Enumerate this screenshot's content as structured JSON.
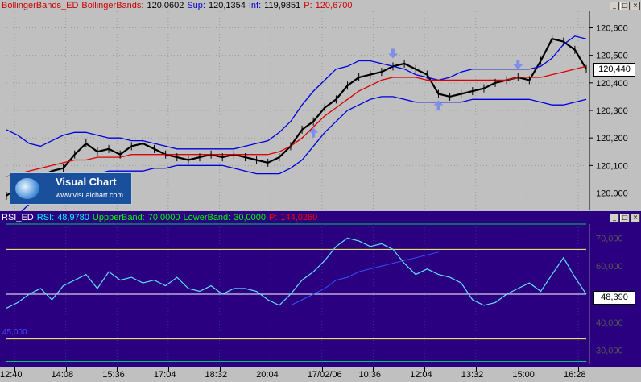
{
  "windows": {
    "price": {
      "legend": [
        {
          "text": "BollingerBands_ED",
          "color": "#cc0000"
        },
        {
          "text": "BollingerBands:",
          "color": "#cc0000"
        },
        {
          "text": "120,0602",
          "color": "#000000"
        },
        {
          "text": "Sup:",
          "color": "#0000cc"
        },
        {
          "text": "120,1354",
          "color": "#000000"
        },
        {
          "text": "Inf:",
          "color": "#0000cc"
        },
        {
          "text": "119,9851",
          "color": "#000000"
        },
        {
          "text": "P:",
          "color": "#cc0000"
        },
        {
          "text": "120,6700",
          "color": "#cc0000"
        }
      ],
      "last_price_label": "120,440",
      "logo": {
        "title": "Visual Chart",
        "url": "www.visualchart.com"
      }
    },
    "rsi": {
      "legend": [
        {
          "text": "RSI_ED",
          "color": "#ffffff"
        },
        {
          "text": "RSI:",
          "color": "#00ffff"
        },
        {
          "text": "48,9780",
          "color": "#00ffff"
        },
        {
          "text": "UppperBand:",
          "color": "#00ff00"
        },
        {
          "text": "70,0000",
          "color": "#00ff00"
        },
        {
          "text": "LowerBand:",
          "color": "#00ff00"
        },
        {
          "text": "30,0000",
          "color": "#00ff00"
        },
        {
          "text": "P:",
          "color": "#ff0000"
        },
        {
          "text": "144,0260",
          "color": "#ff0000"
        }
      ],
      "last_value_label": "48,390",
      "left_label": "45,000"
    },
    "buttons": [
      "_",
      "□",
      "×"
    ]
  },
  "colors": {
    "price_bg": "#c0c0c0",
    "rsi_bg": "#2a0080",
    "grid": "#9a9a9a",
    "upper_band": "#0000dd",
    "lower_band": "#0000dd",
    "mid_band": "#dd0000",
    "price": "#000000",
    "rsi_line": "#66ddff",
    "upper_line": "#ffff66",
    "lower_line": "#ffff66",
    "level_line": "#00cc66",
    "arrow": "#7f8fe8"
  },
  "chart_data": [
    {
      "type": "line",
      "title": "BollingerBands_ED",
      "y_ticks": [
        "120,600",
        "120,500",
        "120,400",
        "120,300",
        "120,200",
        "120,100",
        "120,000"
      ],
      "y_tick_values": [
        120.6,
        120.5,
        120.4,
        120.3,
        120.2,
        120.1,
        120.0
      ],
      "ylim": [
        119.94,
        120.66
      ],
      "grid": true,
      "series": [
        {
          "name": "Price",
          "values": [
            119.99,
            120.02,
            120.04,
            120.06,
            120.08,
            120.09,
            120.14,
            120.18,
            120.15,
            120.16,
            120.14,
            120.17,
            120.18,
            120.16,
            120.14,
            120.13,
            120.12,
            120.13,
            120.14,
            120.13,
            120.14,
            120.13,
            120.12,
            120.11,
            120.13,
            120.17,
            120.23,
            120.26,
            120.31,
            120.34,
            120.39,
            120.42,
            120.43,
            120.44,
            120.46,
            120.47,
            120.45,
            120.43,
            120.36,
            120.35,
            120.36,
            120.37,
            120.38,
            120.4,
            120.41,
            120.42,
            120.41,
            120.48,
            120.56,
            120.55,
            120.52,
            120.45
          ]
        },
        {
          "name": "Upper Band",
          "values": [
            120.23,
            120.21,
            120.18,
            120.17,
            120.19,
            120.21,
            120.22,
            120.22,
            120.21,
            120.2,
            120.2,
            120.19,
            120.19,
            120.18,
            120.17,
            120.16,
            120.16,
            120.16,
            120.16,
            120.16,
            120.16,
            120.17,
            120.18,
            120.19,
            120.22,
            120.26,
            120.32,
            120.37,
            120.41,
            120.45,
            120.46,
            120.48,
            120.48,
            120.47,
            120.46,
            120.45,
            120.43,
            120.42,
            120.41,
            120.42,
            120.44,
            120.45,
            120.45,
            120.45,
            120.45,
            120.45,
            120.45,
            120.46,
            120.49,
            120.54,
            120.57,
            120.56
          ]
        },
        {
          "name": "Middle Band",
          "values": [
            120.06,
            120.07,
            120.08,
            120.09,
            120.1,
            120.11,
            120.12,
            120.12,
            120.13,
            120.13,
            120.13,
            120.14,
            120.14,
            120.14,
            120.14,
            120.14,
            120.14,
            120.14,
            120.14,
            120.14,
            120.14,
            120.14,
            120.14,
            120.14,
            120.15,
            120.17,
            120.2,
            120.24,
            120.28,
            120.31,
            120.34,
            120.37,
            120.39,
            120.41,
            120.42,
            120.42,
            120.42,
            120.41,
            120.41,
            120.41,
            120.41,
            120.41,
            120.41,
            120.41,
            120.41,
            120.42,
            120.42,
            120.42,
            120.43,
            120.44,
            120.45,
            120.46
          ]
        },
        {
          "name": "Lower Band",
          "values": [
            119.91,
            119.92,
            119.96,
            120.0,
            120.03,
            120.05,
            120.06,
            120.07,
            120.07,
            120.08,
            120.08,
            120.08,
            120.08,
            120.09,
            120.09,
            120.1,
            120.1,
            120.1,
            120.1,
            120.1,
            120.09,
            120.08,
            120.07,
            120.07,
            120.07,
            120.09,
            120.12,
            120.17,
            120.22,
            120.26,
            120.3,
            120.32,
            120.34,
            120.35,
            120.35,
            120.34,
            120.33,
            120.33,
            120.33,
            120.33,
            120.33,
            120.34,
            120.34,
            120.34,
            120.34,
            120.34,
            120.34,
            120.33,
            120.32,
            120.32,
            120.33,
            120.34
          ]
        }
      ]
    },
    {
      "type": "line",
      "title": "RSI_ED",
      "y_ticks": [
        "70,000",
        "60,000",
        "50,000",
        "40,000",
        "30,000"
      ],
      "y_tick_values": [
        70,
        60,
        50,
        40,
        30
      ],
      "ylim": [
        25,
        75
      ],
      "grid": true,
      "horizontal_lines": [
        75,
        66,
        50,
        34,
        26
      ],
      "x_ticks": [
        "12:40",
        "14:08",
        "15:36",
        "17:04",
        "18:32",
        "20:04",
        "17/02/06",
        "10:36",
        "12:04",
        "13:32",
        "15:00",
        "16:28"
      ],
      "series": [
        {
          "name": "RSI",
          "values": [
            45,
            47,
            50,
            52,
            48,
            53,
            55,
            57,
            52,
            58,
            55,
            56,
            54,
            55,
            53,
            56,
            52,
            51,
            53,
            50,
            52,
            52,
            51,
            48,
            46,
            50,
            55,
            58,
            62,
            67,
            70,
            69,
            67,
            68,
            66,
            61,
            57,
            59,
            57,
            56,
            54,
            48,
            46,
            47,
            50,
            52,
            54,
            51,
            57,
            63,
            56,
            50
          ]
        },
        {
          "name": "Trend Line",
          "values": [
            null,
            null,
            null,
            null,
            null,
            null,
            null,
            null,
            null,
            null,
            null,
            null,
            null,
            null,
            null,
            null,
            null,
            null,
            null,
            null,
            null,
            null,
            null,
            null,
            null,
            46,
            48,
            50,
            52,
            55,
            56,
            58,
            59,
            60,
            61,
            62,
            63,
            64,
            65,
            null,
            null,
            null,
            null,
            null,
            null,
            null,
            null,
            null,
            null,
            null,
            null,
            null
          ]
        }
      ]
    }
  ]
}
